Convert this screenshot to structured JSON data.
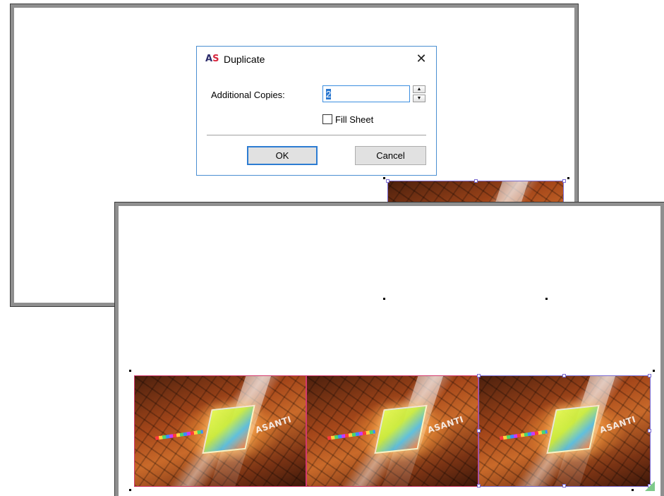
{
  "dialog": {
    "title": "Duplicate",
    "app_icon_letters": [
      "A",
      "S"
    ],
    "close_glyph": "✕",
    "additional_copies_label": "Additional Copies:",
    "additional_copies_value": "2",
    "spin_up_glyph": "▲",
    "spin_down_glyph": "▼",
    "fill_sheet_label": "Fill Sheet",
    "fill_sheet_checked": false,
    "ok_label": "OK",
    "cancel_label": "Cancel"
  },
  "artwork": {
    "brand_text": "ASANTI",
    "selection_color": "#7a6ad0",
    "copy_border_color": "#d23a6e"
  },
  "colors": {
    "dialog_border": "#4a8fd1",
    "focus_blue": "#2c7cd2",
    "frame_gray": "#8f8f8f",
    "tab_green": "#7ec98a"
  },
  "icons": {
    "app_icon": "asanti-logo-icon",
    "close": "close-icon",
    "spin_up": "arrow-up-icon",
    "spin_down": "arrow-down-icon"
  }
}
